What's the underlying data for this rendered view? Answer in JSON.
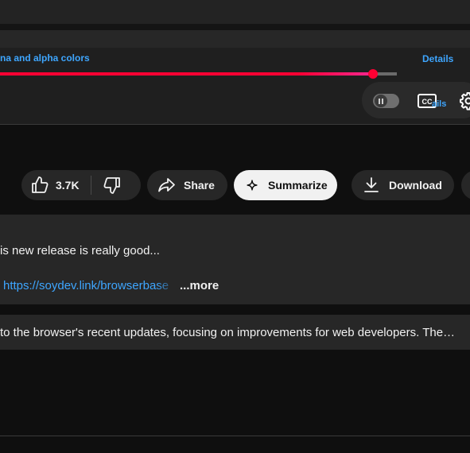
{
  "player": {
    "chapter_title": "na and alpha colors",
    "details_label": "Details",
    "details_ghost_label": "ails",
    "progress_percent": 79.5
  },
  "actions": {
    "like_count": "3.7K",
    "share_label": "Share",
    "summarize_label": "Summarize",
    "download_label": "Download"
  },
  "description": {
    "line1": "is new release is really good...",
    "link": "https://soydev.link/browserbase",
    "more_label": "...more"
  },
  "summary": {
    "text": "to the browser's recent updates, focusing on improvements for web developers. The…"
  },
  "colors": {
    "accent_red": "#ff0033",
    "link_blue": "#3ea6ff",
    "background": "#0f0f0f",
    "surface": "#272727"
  }
}
